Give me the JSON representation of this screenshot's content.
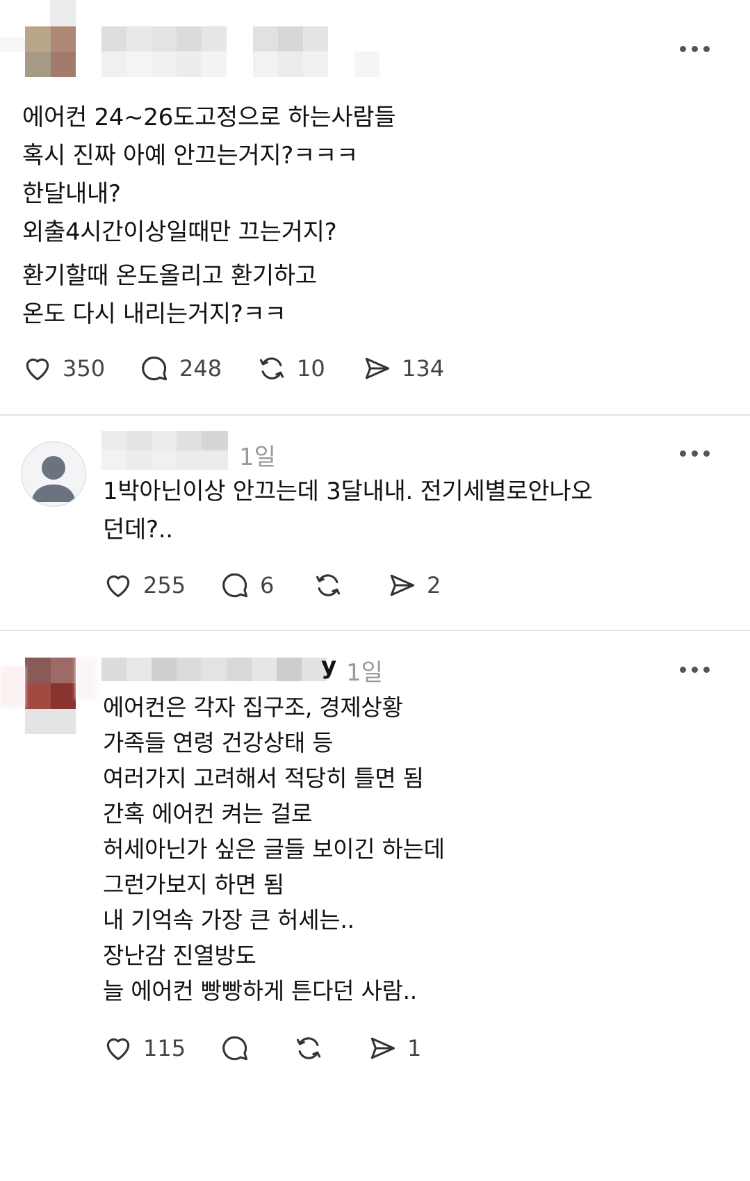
{
  "posts": [
    {
      "body": "에어컨 24~26도고정으로 하는사람들\n혹시 진짜 아예 안끄는거지?ㅋㅋㅋ\n한달내내?\n외출4시간이상일때만 끄는거지?",
      "body2": "환기할때 온도올리고 환기하고\n온도 다시 내리는거지?ㅋㅋ",
      "likes": "350",
      "comments": "248",
      "reposts": "10",
      "shares": "134"
    },
    {
      "time": "1일",
      "body": "1박아닌이상 안끄는데 3달내내. 전기세별로안나오\n던데?..",
      "likes": "255",
      "comments": "6",
      "reposts": "",
      "shares": "2"
    },
    {
      "time": "1일",
      "name_tail": "y",
      "body": "에어컨은 각자 집구조, 경제상황\n가족들 연령 건강상태 등\n여러가지 고려해서 적당히 틀면 됨\n간혹 에어컨 켜는 걸로\n허세아닌가 싶은 글들 보이긴 하는데\n그런가보지 하면 됨\n내 기억속 가장 큰 허세는..\n장난감 진열방도\n늘 에어컨 빵빵하게 튼다던 사람..",
      "likes": "115",
      "comments": "",
      "reposts": "",
      "shares": "1"
    }
  ],
  "icons": {
    "like": "heart-icon",
    "comment": "comment-bubble-icon",
    "repost": "repost-icon",
    "share": "send-icon",
    "more": "more-dots-icon",
    "avatar": "default-avatar-icon"
  },
  "colors": {
    "text": "#111111",
    "muted": "#9a9a9a",
    "icon": "#333333",
    "divider": "#e4e4e4"
  }
}
